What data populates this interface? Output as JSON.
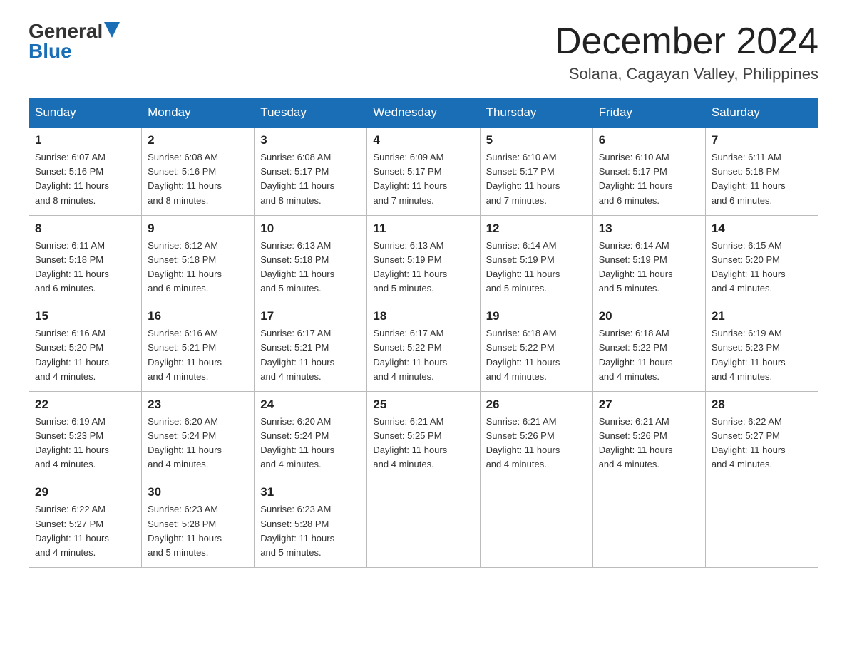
{
  "logo": {
    "general": "General",
    "blue": "Blue",
    "tagline": ""
  },
  "title": "December 2024",
  "subtitle": "Solana, Cagayan Valley, Philippines",
  "weekdays": [
    "Sunday",
    "Monday",
    "Tuesday",
    "Wednesday",
    "Thursday",
    "Friday",
    "Saturday"
  ],
  "weeks": [
    [
      {
        "day": "1",
        "sunrise": "6:07 AM",
        "sunset": "5:16 PM",
        "daylight": "11 hours and 8 minutes."
      },
      {
        "day": "2",
        "sunrise": "6:08 AM",
        "sunset": "5:16 PM",
        "daylight": "11 hours and 8 minutes."
      },
      {
        "day": "3",
        "sunrise": "6:08 AM",
        "sunset": "5:17 PM",
        "daylight": "11 hours and 8 minutes."
      },
      {
        "day": "4",
        "sunrise": "6:09 AM",
        "sunset": "5:17 PM",
        "daylight": "11 hours and 7 minutes."
      },
      {
        "day": "5",
        "sunrise": "6:10 AM",
        "sunset": "5:17 PM",
        "daylight": "11 hours and 7 minutes."
      },
      {
        "day": "6",
        "sunrise": "6:10 AM",
        "sunset": "5:17 PM",
        "daylight": "11 hours and 6 minutes."
      },
      {
        "day": "7",
        "sunrise": "6:11 AM",
        "sunset": "5:18 PM",
        "daylight": "11 hours and 6 minutes."
      }
    ],
    [
      {
        "day": "8",
        "sunrise": "6:11 AM",
        "sunset": "5:18 PM",
        "daylight": "11 hours and 6 minutes."
      },
      {
        "day": "9",
        "sunrise": "6:12 AM",
        "sunset": "5:18 PM",
        "daylight": "11 hours and 6 minutes."
      },
      {
        "day": "10",
        "sunrise": "6:13 AM",
        "sunset": "5:18 PM",
        "daylight": "11 hours and 5 minutes."
      },
      {
        "day": "11",
        "sunrise": "6:13 AM",
        "sunset": "5:19 PM",
        "daylight": "11 hours and 5 minutes."
      },
      {
        "day": "12",
        "sunrise": "6:14 AM",
        "sunset": "5:19 PM",
        "daylight": "11 hours and 5 minutes."
      },
      {
        "day": "13",
        "sunrise": "6:14 AM",
        "sunset": "5:19 PM",
        "daylight": "11 hours and 5 minutes."
      },
      {
        "day": "14",
        "sunrise": "6:15 AM",
        "sunset": "5:20 PM",
        "daylight": "11 hours and 4 minutes."
      }
    ],
    [
      {
        "day": "15",
        "sunrise": "6:16 AM",
        "sunset": "5:20 PM",
        "daylight": "11 hours and 4 minutes."
      },
      {
        "day": "16",
        "sunrise": "6:16 AM",
        "sunset": "5:21 PM",
        "daylight": "11 hours and 4 minutes."
      },
      {
        "day": "17",
        "sunrise": "6:17 AM",
        "sunset": "5:21 PM",
        "daylight": "11 hours and 4 minutes."
      },
      {
        "day": "18",
        "sunrise": "6:17 AM",
        "sunset": "5:22 PM",
        "daylight": "11 hours and 4 minutes."
      },
      {
        "day": "19",
        "sunrise": "6:18 AM",
        "sunset": "5:22 PM",
        "daylight": "11 hours and 4 minutes."
      },
      {
        "day": "20",
        "sunrise": "6:18 AM",
        "sunset": "5:22 PM",
        "daylight": "11 hours and 4 minutes."
      },
      {
        "day": "21",
        "sunrise": "6:19 AM",
        "sunset": "5:23 PM",
        "daylight": "11 hours and 4 minutes."
      }
    ],
    [
      {
        "day": "22",
        "sunrise": "6:19 AM",
        "sunset": "5:23 PM",
        "daylight": "11 hours and 4 minutes."
      },
      {
        "day": "23",
        "sunrise": "6:20 AM",
        "sunset": "5:24 PM",
        "daylight": "11 hours and 4 minutes."
      },
      {
        "day": "24",
        "sunrise": "6:20 AM",
        "sunset": "5:24 PM",
        "daylight": "11 hours and 4 minutes."
      },
      {
        "day": "25",
        "sunrise": "6:21 AM",
        "sunset": "5:25 PM",
        "daylight": "11 hours and 4 minutes."
      },
      {
        "day": "26",
        "sunrise": "6:21 AM",
        "sunset": "5:26 PM",
        "daylight": "11 hours and 4 minutes."
      },
      {
        "day": "27",
        "sunrise": "6:21 AM",
        "sunset": "5:26 PM",
        "daylight": "11 hours and 4 minutes."
      },
      {
        "day": "28",
        "sunrise": "6:22 AM",
        "sunset": "5:27 PM",
        "daylight": "11 hours and 4 minutes."
      }
    ],
    [
      {
        "day": "29",
        "sunrise": "6:22 AM",
        "sunset": "5:27 PM",
        "daylight": "11 hours and 4 minutes."
      },
      {
        "day": "30",
        "sunrise": "6:23 AM",
        "sunset": "5:28 PM",
        "daylight": "11 hours and 5 minutes."
      },
      {
        "day": "31",
        "sunrise": "6:23 AM",
        "sunset": "5:28 PM",
        "daylight": "11 hours and 5 minutes."
      },
      null,
      null,
      null,
      null
    ]
  ],
  "labels": {
    "sunrise": "Sunrise:",
    "sunset": "Sunset:",
    "daylight": "Daylight:"
  }
}
